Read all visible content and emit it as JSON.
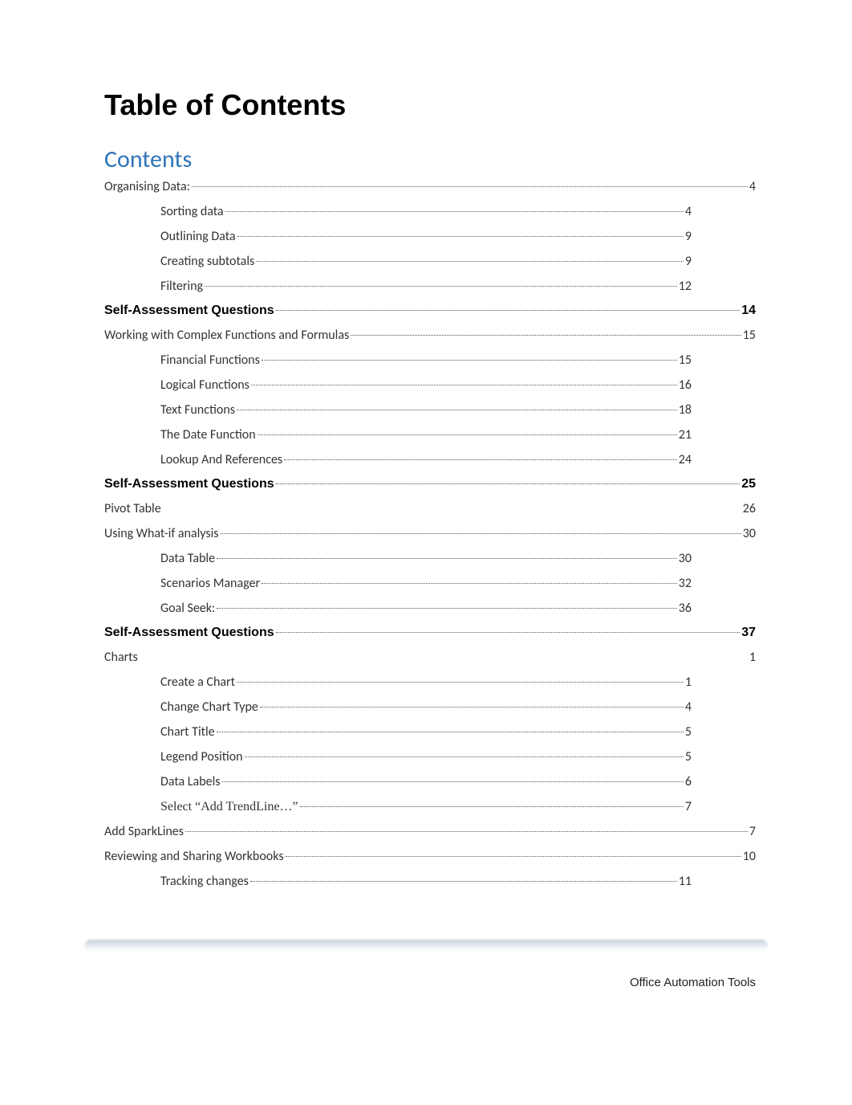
{
  "title": "Table of Contents",
  "subtitle": "Contents",
  "footer": "Office Automation Tools",
  "entries": [
    {
      "label": "Organising Data:",
      "page": "4",
      "level": 1,
      "bold": false,
      "leader": true
    },
    {
      "label": "Sorting data",
      "page": "4",
      "level": 2,
      "bold": false,
      "leader": true
    },
    {
      "label": "Outlining Data",
      "page": "9",
      "level": 2,
      "bold": false,
      "leader": true
    },
    {
      "label": "Creating subtotals",
      "page": "9",
      "level": 2,
      "bold": false,
      "leader": true
    },
    {
      "label": "Filtering",
      "page": "12",
      "level": 2,
      "bold": false,
      "leader": true
    },
    {
      "label": "Self-Assessment Questions",
      "page": "14",
      "level": 1,
      "bold": true,
      "leader": true
    },
    {
      "label": "Working with Complex Functions and Formulas",
      "page": "15",
      "level": 1,
      "bold": false,
      "leader": true
    },
    {
      "label": "Financial Functions",
      "page": "15",
      "level": 2,
      "bold": false,
      "leader": true
    },
    {
      "label": "Logical Functions",
      "page": "16",
      "level": 2,
      "bold": false,
      "leader": true
    },
    {
      "label": "Text Functions",
      "page": "18",
      "level": 2,
      "bold": false,
      "leader": true
    },
    {
      "label": "The Date Function",
      "page": "21",
      "level": 2,
      "bold": false,
      "leader": true
    },
    {
      "label": "Lookup And References",
      "page": "24",
      "level": 2,
      "bold": false,
      "leader": true
    },
    {
      "label": "Self-Assessment Questions",
      "page": "25",
      "level": 1,
      "bold": true,
      "leader": true
    },
    {
      "label": "Pivot Table",
      "page": "26",
      "level": 1,
      "bold": false,
      "leader": false
    },
    {
      "label": "Using What-if analysis",
      "page": "30",
      "level": 1,
      "bold": false,
      "leader": true
    },
    {
      "label": "Data Table",
      "page": "30",
      "level": 2,
      "bold": false,
      "leader": true
    },
    {
      "label": "Scenarios Manager",
      "page": "32",
      "level": 2,
      "bold": false,
      "leader": true
    },
    {
      "label": "Goal Seek:",
      "page": "36",
      "level": 2,
      "bold": false,
      "leader": true
    },
    {
      "label": "Self-Assessment Questions",
      "page": "37",
      "level": 1,
      "bold": true,
      "leader": true
    },
    {
      "label": "Charts",
      "page": "1",
      "level": 1,
      "bold": false,
      "leader": false
    },
    {
      "label": "Create a Chart",
      "page": "1",
      "level": 2,
      "bold": false,
      "leader": true
    },
    {
      "label": "Change Chart Type",
      "page": "4",
      "level": 2,
      "bold": false,
      "leader": true
    },
    {
      "label": "Chart Title",
      "page": "5",
      "level": 2,
      "bold": false,
      "leader": true
    },
    {
      "label": "Legend Position",
      "page": "5",
      "level": 2,
      "bold": false,
      "leader": true
    },
    {
      "label": "Data Labels",
      "page": "6",
      "level": 2,
      "bold": false,
      "leader": true
    },
    {
      "label": "Select “Add TrendLine…”",
      "page": "7",
      "level": 2,
      "bold": false,
      "leader": true,
      "serif": true
    },
    {
      "label": "Add SparkLines",
      "page": "7",
      "level": 1,
      "bold": false,
      "leader": true
    },
    {
      "label": "Reviewing and Sharing Workbooks",
      "page": "10",
      "level": 1,
      "bold": false,
      "leader": true
    },
    {
      "label": "Tracking changes",
      "page": "11",
      "level": 2,
      "bold": false,
      "leader": true
    }
  ]
}
